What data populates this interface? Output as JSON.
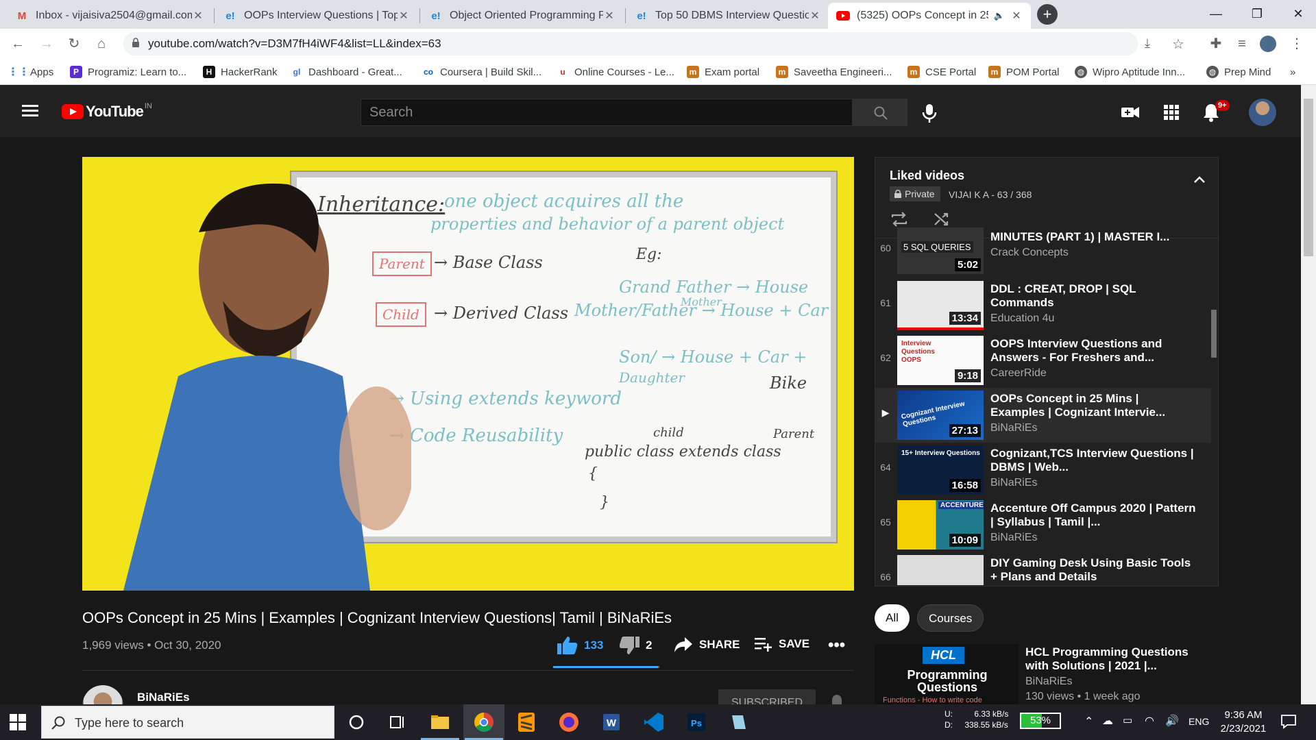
{
  "browser": {
    "tabs": [
      {
        "title": "Inbox - vijaisiva2504@gmail.com",
        "icon": "gmail-icon"
      },
      {
        "title": "OOPs Interview Questions | Top 5",
        "icon": "edureka-icon"
      },
      {
        "title": "Object Oriented Programming Py",
        "icon": "edureka-icon"
      },
      {
        "title": "Top 50 DBMS Interview Question",
        "icon": "edureka-icon"
      },
      {
        "title": "(5325) OOPs Concept in 25 M",
        "icon": "youtube-icon",
        "active": true
      }
    ],
    "url": "youtube.com/watch?v=D3M7fH4iWF4&list=LL&index=63",
    "bookmarks": [
      {
        "label": "Apps",
        "color": "#ea4335"
      },
      {
        "label": "Programiz: Learn to...",
        "color": "#5b2bd6"
      },
      {
        "label": "HackerRank",
        "color": "#1ba94c"
      },
      {
        "label": "Dashboard - Great...",
        "color": "#3872d8"
      },
      {
        "label": "Coursera | Build Skil...",
        "color": "#0056d2"
      },
      {
        "label": "Online Courses - Le...",
        "color": "#d52a1c"
      },
      {
        "label": "Exam portal",
        "color": "#c9741c"
      },
      {
        "label": "Saveetha Engineeri...",
        "color": "#c9741c"
      },
      {
        "label": "CSE Portal",
        "color": "#c9741c"
      },
      {
        "label": "POM Portal",
        "color": "#c9741c"
      },
      {
        "label": "Wipro Aptitude Inn...",
        "color": "#555555"
      },
      {
        "label": "Prep Mind",
        "color": "#555555"
      }
    ],
    "more_bookmarks": "»"
  },
  "youtube": {
    "logo_text": "YouTube",
    "region": "IN",
    "search_placeholder": "Search",
    "notification_count": "9+",
    "video": {
      "title": "OOPs Concept in 25 Mins | Examples | Cognizant Interview Questions| Tamil | BiNaRiEs",
      "views": "1,969 views • Oct 30, 2020",
      "likes": "133",
      "dislikes": "2",
      "like_ratio": 0.985,
      "share_label": "SHARE",
      "save_label": "SAVE",
      "channel": "BiNaRiEs",
      "subscribe_label": "SUBSCRIBED"
    },
    "board": {
      "heading": "Inheritance:",
      "def1": "one object acquires all the",
      "def2": "properties and behavior of a parent object",
      "parent": "Parent",
      "base": "→ Base Class",
      "child": "Child",
      "derived": "→ Derived Class",
      "eg": "Eg:",
      "l1": "Grand Father → House",
      "mother": "Mother",
      "l2": "Mother/Father → House + Car",
      "l3": "Son/ → House + Car +",
      "daughter": "Daughter",
      "bike": "Bike",
      "using": "→ Using extends keyword",
      "reuse": "→ Code Reusability",
      "code": "public class extends class",
      "childw": "child",
      "parentw": "Parent",
      "brace_open": "{",
      "brace_close": "}"
    },
    "playlist": {
      "title": "Liked videos",
      "privacy": "Private",
      "owner": "VIJAI K A - 63 / 368",
      "items": [
        {
          "index": "60",
          "title": "MINUTES (PART 1) | MASTER I...",
          "channel": "Crack Concepts",
          "duration": "5:02",
          "thumb_text": "5 SQL QUERIES"
        },
        {
          "index": "61",
          "title": "DDL : CREAT, DROP | SQL Commands",
          "channel": "Education 4u",
          "duration": "13:34",
          "thumb_text": ""
        },
        {
          "index": "62",
          "title": "OOPS Interview Questions and Answers - For Freshers and...",
          "channel": "CareerRide",
          "duration": "9:18",
          "thumb_text": "Interview Questions OOPS"
        },
        {
          "index": "▶",
          "title": "OOPs Concept in 25 Mins | Examples | Cognizant Intervie...",
          "channel": "BiNaRiEs",
          "duration": "27:13",
          "thumb_text": "Cognizant Interview Questions",
          "current": true
        },
        {
          "index": "64",
          "title": "Cognizant,TCS Interview Questions | DBMS | Web...",
          "channel": "BiNaRiEs",
          "duration": "16:58",
          "thumb_text": "15+ Interview Questions"
        },
        {
          "index": "65",
          "title": "Accenture Off Campus 2020 | Pattern | Syllabus | Tamil |...",
          "channel": "BiNaRiEs",
          "duration": "10:09",
          "thumb_text": "ACCENTURE"
        },
        {
          "index": "66",
          "title": "DIY Gaming Desk Using Basic Tools + Plans and Details",
          "channel": "",
          "duration": "",
          "thumb_text": ""
        }
      ]
    },
    "chips": [
      "All",
      "Courses"
    ],
    "recommendation": {
      "title": "HCL Programming Questions with Solutions | 2021 |...",
      "channel": "BiNaRiEs",
      "meta": "130 views • 1 week ago",
      "thumb_brand": "HCL",
      "thumb_text": "Programming Questions",
      "thumb_sub": "Functions - How to write code"
    }
  },
  "taskbar": {
    "search_placeholder": "Type here to search",
    "upload": "U:",
    "upload_rate": "6.33 kB/s",
    "download": "D:",
    "download_rate": "338.55 kB/s",
    "battery": "53%",
    "battery_level": 0.53,
    "language": "ENG",
    "time": "9:36 AM",
    "date": "2/23/2021"
  }
}
